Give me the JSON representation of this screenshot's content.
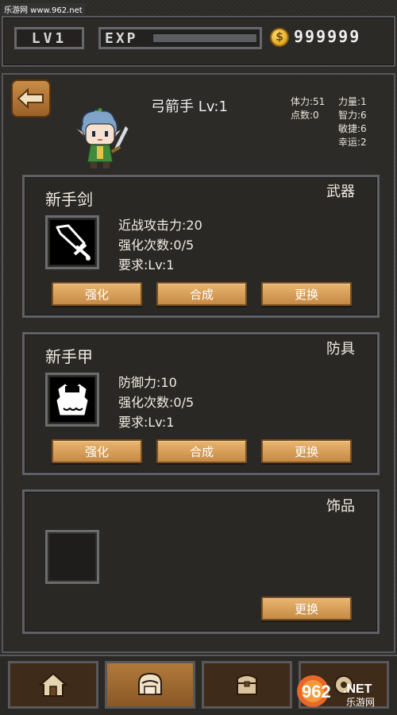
{
  "watermark": "乐游网 www.962.net",
  "topbar": {
    "level": "LV1",
    "exp_label": "EXP",
    "exp_progress": 0.0,
    "gold": "999999"
  },
  "character": {
    "name": "弓箭手 Lv:1",
    "stats_col1": [
      "体力:51",
      "点数:0"
    ],
    "stats_col2": [
      "力量:1",
      "智力:6",
      "敏捷:6",
      "幸运:2"
    ]
  },
  "equipment": [
    {
      "name": "新手剑",
      "type": "武器",
      "icon": "sword-icon",
      "attrs": [
        "近战攻击力:20",
        "强化次数:0/5",
        "要求:Lv:1"
      ],
      "buttons": [
        "强化",
        "合成",
        "更换"
      ]
    },
    {
      "name": "新手甲",
      "type": "防具",
      "icon": "armor-icon",
      "attrs": [
        "防御力:10",
        "强化次数:0/5",
        "要求:Lv:1"
      ],
      "buttons": [
        "强化",
        "合成",
        "更换"
      ]
    },
    {
      "name": "",
      "type": "饰品",
      "icon": "empty-slot",
      "attrs": [],
      "buttons": [
        "更换"
      ]
    }
  ],
  "bottom_nav": [
    {
      "icon": "home-icon"
    },
    {
      "icon": "character-icon",
      "active": true
    },
    {
      "icon": "chest-icon"
    },
    {
      "icon": "settings-icon"
    }
  ],
  "logo": {
    "text": "962",
    "net": ".NET",
    "sub": "乐游网"
  },
  "colors": {
    "button": "#d9a25e",
    "panel_border": "#5f6166",
    "coin": "#e0a61f"
  }
}
